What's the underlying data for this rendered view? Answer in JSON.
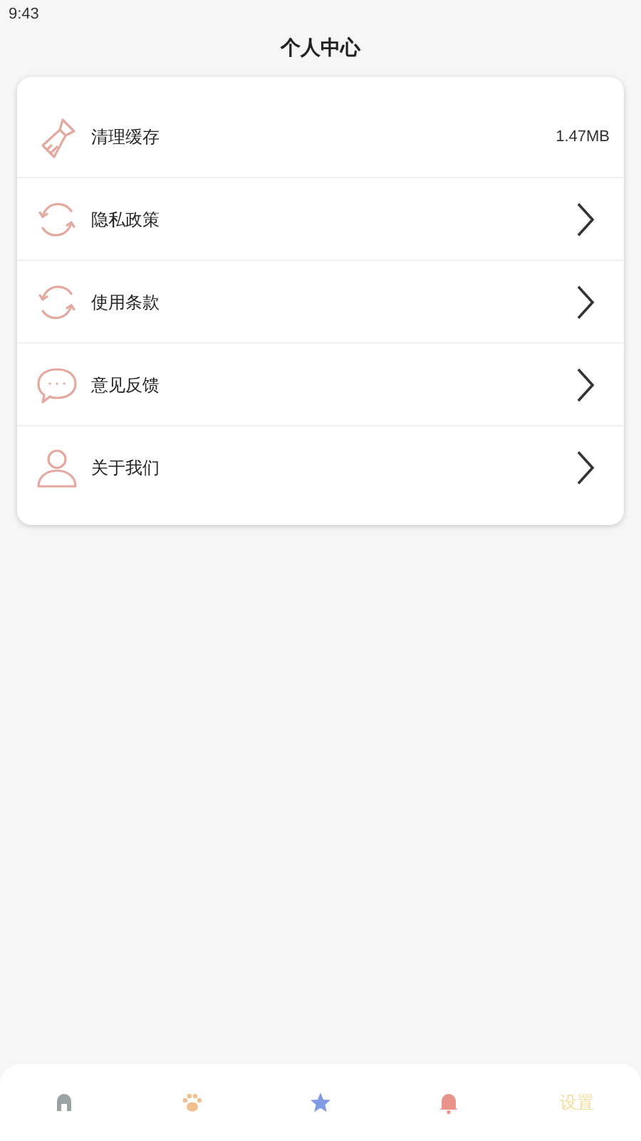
{
  "status_bar": {
    "time": "9:43"
  },
  "title": "个人中心",
  "menu": [
    {
      "kind": "value",
      "label": "清理缓存",
      "value": "1.47MB"
    },
    {
      "kind": "link",
      "label": "隐私政策"
    },
    {
      "kind": "link",
      "label": "使用条款"
    },
    {
      "kind": "link",
      "label": "意见反馈"
    },
    {
      "kind": "link",
      "label": "关于我们"
    }
  ],
  "tab_bar": [
    {
      "kind": "icon",
      "color": "#9aa3a3"
    },
    {
      "kind": "icon",
      "color": "#efc08e"
    },
    {
      "kind": "icon",
      "color": "#7f9be3"
    },
    {
      "kind": "icon",
      "color": "#e8948a"
    },
    {
      "kind": "text",
      "label": "设置",
      "color": "#f5dc9a"
    }
  ]
}
